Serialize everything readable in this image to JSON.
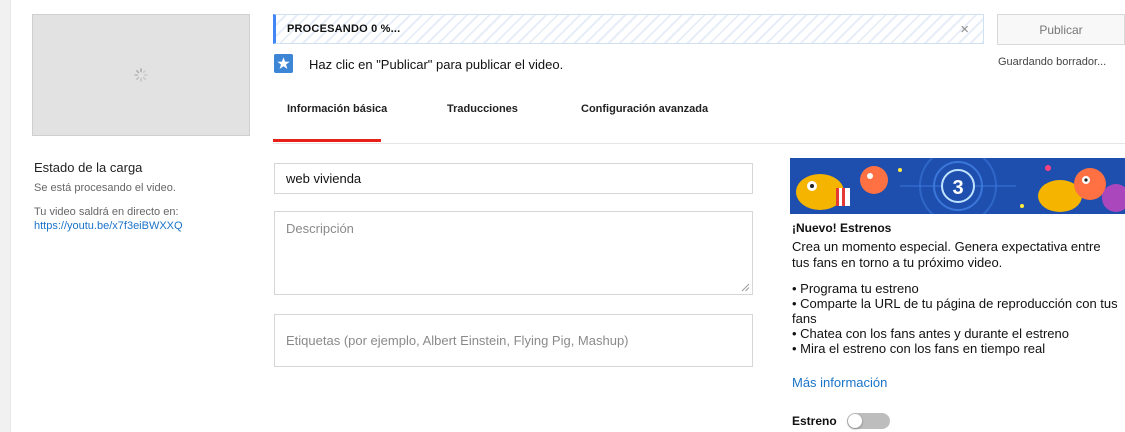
{
  "upload_status": {
    "title": "Estado de la carga",
    "processing": "Se está procesando el video.",
    "live_text": "Tu video saldrá en directo en:",
    "link": "https://youtu.be/x7f3eiBWXXQ"
  },
  "progress": {
    "text": "PROCESANDO 0 %...",
    "value": 0,
    "close": "×"
  },
  "actions": {
    "publish": "Publicar",
    "saving": "Guardando borrador..."
  },
  "hint": "Haz clic en \"Publicar\" para publicar el video.",
  "tabs": [
    {
      "label": "Información básica",
      "active": true
    },
    {
      "label": "Traducciones",
      "active": false
    },
    {
      "label": "Configuración avanzada",
      "active": false
    }
  ],
  "form": {
    "title_value": "web vivienda",
    "description_placeholder": "Descripción",
    "tags_placeholder": "Etiquetas (por ejemplo, Albert Einstein, Flying Pig, Mashup)"
  },
  "premiere": {
    "banner_number": "3",
    "title": "¡Nuevo! Estrenos",
    "description": "Crea un momento especial. Genera expectativa entre tus fans en torno a tu próximo video.",
    "bullets": [
      "• Programa tu estreno",
      "• Comparte la URL de tu página de reproducción con tus fans",
      "• Chatea con los fans antes y durante el estreno",
      "• Mira el estreno con los fans en tiempo real"
    ],
    "more_info": "Más información",
    "toggle_label": "Estreno",
    "toggle_on": false
  },
  "colors": {
    "accent_blue": "#4285f4",
    "link_blue": "#1a73c8",
    "tab_active_red": "#e62117",
    "banner_blue": "#1f4fae"
  },
  "icons": {
    "spinner": "loading-spinner-icon",
    "star": "star-icon",
    "close": "close-icon",
    "resize": "resize-handle-icon"
  }
}
